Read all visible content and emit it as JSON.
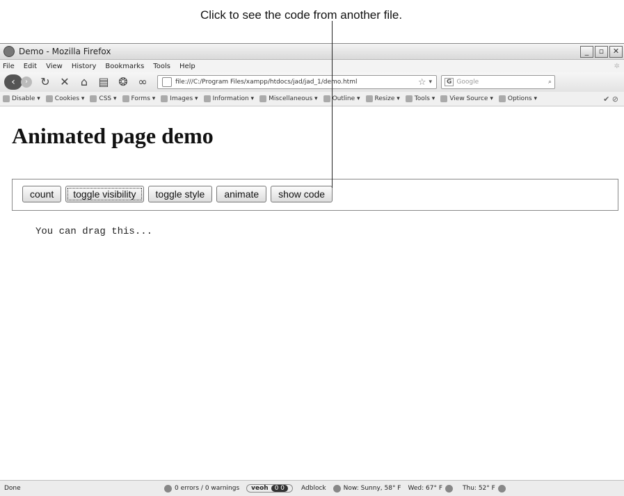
{
  "callout": {
    "text": "Click to see the code from another file."
  },
  "window": {
    "title": "Demo - Mozilla Firefox",
    "controls": [
      "_",
      "▫",
      "✕"
    ]
  },
  "menu": [
    "File",
    "Edit",
    "View",
    "History",
    "Bookmarks",
    "Tools",
    "Help"
  ],
  "nav": {
    "url": "file:///C:/Program Files/xampp/htdocs/jad/jad_1/demo.html",
    "search_placeholder": "Google",
    "search_engine": "G"
  },
  "devbar": {
    "items": [
      "Disable",
      "Cookies",
      "CSS",
      "Forms",
      "Images",
      "Information",
      "Miscellaneous",
      "Outline",
      "Resize",
      "Tools",
      "View Source",
      "Options"
    ]
  },
  "page": {
    "heading": "Animated page demo",
    "buttons": {
      "count": "count",
      "toggle_visibility": "toggle visibility",
      "toggle_style": "toggle style",
      "animate": "animate",
      "show_code": "show code"
    },
    "drag_text": "You can drag this..."
  },
  "status": {
    "left": "Done",
    "errors": "0 errors / 0 warnings",
    "veoh": "veoh",
    "veoh_counts": "0  0",
    "adblock": "Adblock",
    "now": "Now: Sunny, 58° F",
    "wed": "Wed: 67° F",
    "thu": "Thu: 52° F"
  }
}
